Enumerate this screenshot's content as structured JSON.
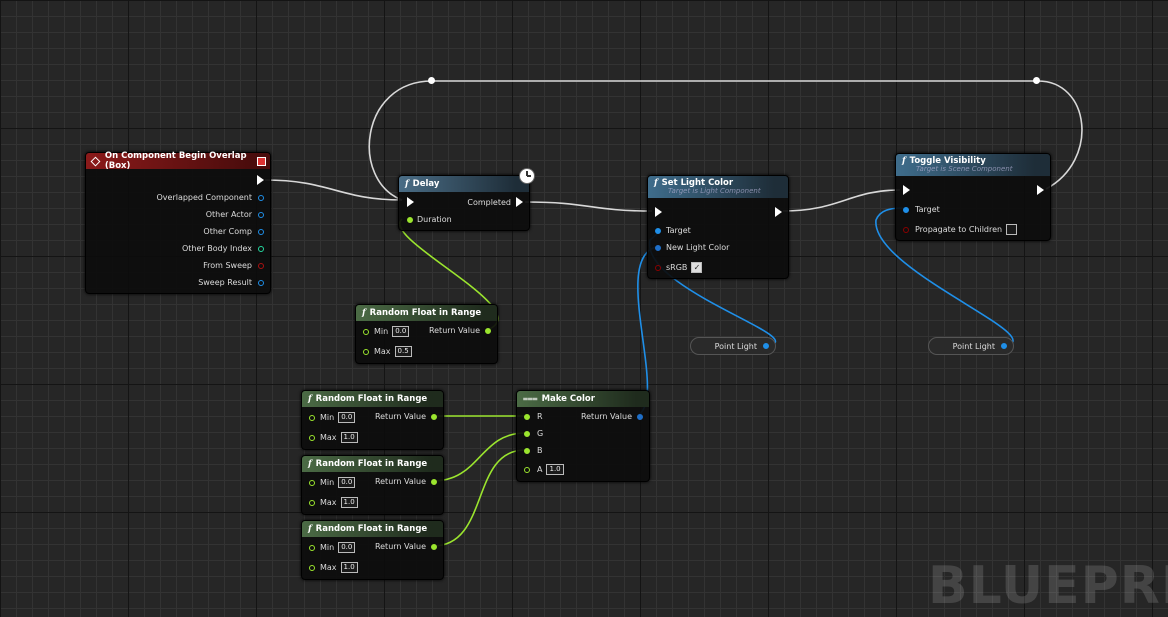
{
  "colors": {
    "exec": "#ffffff",
    "float": "#9be52e",
    "struct": "#1f8fe8",
    "bool": "#8b0000",
    "int": "#25d8a0"
  },
  "event_node": {
    "title": "On Component Begin Overlap (Box)",
    "outputs": [
      "Overlapped Component",
      "Other Actor",
      "Other Comp",
      "Other Body Index",
      "From Sweep",
      "Sweep Result"
    ]
  },
  "delay_node": {
    "title": "Delay",
    "completed": "Completed",
    "duration": "Duration"
  },
  "set_light_node": {
    "title": "Set Light Color",
    "subtitle": "Target is Light Component",
    "target": "Target",
    "new_color": "New Light Color",
    "srgb": "sRGB"
  },
  "toggle_node": {
    "title": "Toggle Visibility",
    "subtitle": "Target is Scene Component",
    "target": "Target",
    "propagate": "Propagate to Children"
  },
  "random_nodes": [
    {
      "title": "Random Float in Range",
      "min_label": "Min",
      "min": "0.0",
      "max_label": "Max",
      "max": "0.5",
      "ret": "Return Value"
    },
    {
      "title": "Random Float in Range",
      "min_label": "Min",
      "min": "0.0",
      "max_label": "Max",
      "max": "1.0",
      "ret": "Return Value"
    },
    {
      "title": "Random Float in Range",
      "min_label": "Min",
      "min": "0.0",
      "max_label": "Max",
      "max": "1.0",
      "ret": "Return Value"
    },
    {
      "title": "Random Float in Range",
      "min_label": "Min",
      "min": "0.0",
      "max_label": "Max",
      "max": "1.0",
      "ret": "Return Value"
    }
  ],
  "make_color_node": {
    "title": "Make Color",
    "ret": "Return Value",
    "r": "R",
    "g": "G",
    "b": "B",
    "a": "A",
    "a_value": "1.0"
  },
  "reroutes": [
    {
      "label": "Point Light"
    },
    {
      "label": "Point Light"
    }
  ],
  "watermark": "BLUEPRIN"
}
